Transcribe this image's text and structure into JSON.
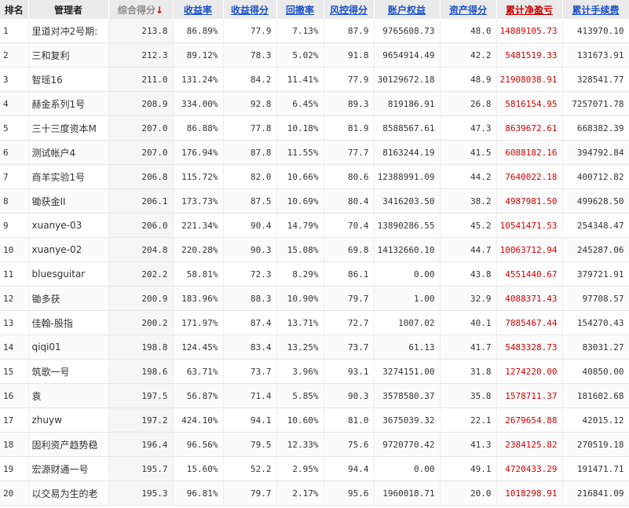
{
  "headers": {
    "rank": "排名",
    "manager": "管理者",
    "composite": "综合得分",
    "sort_arrow": "↓",
    "return_rate": "收益率",
    "return_score": "收益得分",
    "drawdown": "回撤率",
    "risk_score": "风控得分",
    "equity": "账户权益",
    "asset_score": "资产得分",
    "net_pnl": "累计净盈亏",
    "fees": "累计手续费"
  },
  "rows": [
    {
      "rank": "1",
      "manager": "里道对冲2号期:",
      "composite": "213.8",
      "return_rate": "86.89%",
      "return_score": "77.9",
      "drawdown": "7.13%",
      "risk_score": "87.9",
      "equity": "9765608.73",
      "asset_score": "48.0",
      "net_pnl": "14889105.73",
      "fees": "413970.10"
    },
    {
      "rank": "2",
      "manager": "三和复利",
      "composite": "212.3",
      "return_rate": "89.12%",
      "return_score": "78.3",
      "drawdown": "5.02%",
      "risk_score": "91.8",
      "equity": "9654914.49",
      "asset_score": "42.2",
      "net_pnl": "5481519.33",
      "fees": "131673.91"
    },
    {
      "rank": "3",
      "manager": "智瑶16",
      "composite": "211.0",
      "return_rate": "131.24%",
      "return_score": "84.2",
      "drawdown": "11.41%",
      "risk_score": "77.9",
      "equity": "30129672.18",
      "asset_score": "48.9",
      "net_pnl": "21908038.91",
      "fees": "328541.77"
    },
    {
      "rank": "4",
      "manager": "赫金系列1号",
      "composite": "208.9",
      "return_rate": "334.00%",
      "return_score": "92.8",
      "drawdown": "6.45%",
      "risk_score": "89.3",
      "equity": "819186.91",
      "asset_score": "26.8",
      "net_pnl": "5816154.95",
      "fees": "7257071.78"
    },
    {
      "rank": "5",
      "manager": "三十三度资本M",
      "composite": "207.0",
      "return_rate": "86.88%",
      "return_score": "77.8",
      "drawdown": "10.18%",
      "risk_score": "81.9",
      "equity": "8588567.61",
      "asset_score": "47.3",
      "net_pnl": "8639672.61",
      "fees": "668382.39"
    },
    {
      "rank": "6",
      "manager": "测试帐户4",
      "composite": "207.0",
      "return_rate": "176.94%",
      "return_score": "87.8",
      "drawdown": "11.55%",
      "risk_score": "77.7",
      "equity": "8163244.19",
      "asset_score": "41.5",
      "net_pnl": "6088182.16",
      "fees": "394792.84"
    },
    {
      "rank": "7",
      "manager": "商羊实验1号",
      "composite": "206.8",
      "return_rate": "115.72%",
      "return_score": "82.0",
      "drawdown": "10.66%",
      "risk_score": "80.6",
      "equity": "12388991.09",
      "asset_score": "44.2",
      "net_pnl": "7640022.18",
      "fees": "400712.82"
    },
    {
      "rank": "8",
      "manager": "锄获金II",
      "composite": "206.1",
      "return_rate": "173.73%",
      "return_score": "87.5",
      "drawdown": "10.69%",
      "risk_score": "80.4",
      "equity": "3416203.50",
      "asset_score": "38.2",
      "net_pnl": "4987981.50",
      "fees": "499628.50"
    },
    {
      "rank": "9",
      "manager": "xuanye-03",
      "composite": "206.0",
      "return_rate": "221.34%",
      "return_score": "90.4",
      "drawdown": "14.79%",
      "risk_score": "70.4",
      "equity": "13890286.55",
      "asset_score": "45.2",
      "net_pnl": "10541471.53",
      "fees": "254348.47"
    },
    {
      "rank": "10",
      "manager": "xuanye-02",
      "composite": "204.8",
      "return_rate": "220.28%",
      "return_score": "90.3",
      "drawdown": "15.08%",
      "risk_score": "69.8",
      "equity": "14132660.10",
      "asset_score": "44.7",
      "net_pnl": "10063712.94",
      "fees": "245287.06"
    },
    {
      "rank": "11",
      "manager": "bluesguitar",
      "composite": "202.2",
      "return_rate": "58.81%",
      "return_score": "72.3",
      "drawdown": "8.29%",
      "risk_score": "86.1",
      "equity": "0.00",
      "asset_score": "43.8",
      "net_pnl": "4551440.67",
      "fees": "379721.91"
    },
    {
      "rank": "12",
      "manager": "锄多获",
      "composite": "200.9",
      "return_rate": "183.96%",
      "return_score": "88.3",
      "drawdown": "10.90%",
      "risk_score": "79.7",
      "equity": "1.00",
      "asset_score": "32.9",
      "net_pnl": "4088371.43",
      "fees": "97708.57"
    },
    {
      "rank": "13",
      "manager": "佳翰-股指",
      "composite": "200.2",
      "return_rate": "171.97%",
      "return_score": "87.4",
      "drawdown": "13.71%",
      "risk_score": "72.7",
      "equity": "1007.02",
      "asset_score": "40.1",
      "net_pnl": "7885467.44",
      "fees": "154270.43"
    },
    {
      "rank": "14",
      "manager": "qiqi01",
      "composite": "198.8",
      "return_rate": "124.45%",
      "return_score": "83.4",
      "drawdown": "13.25%",
      "risk_score": "73.7",
      "equity": "61.13",
      "asset_score": "41.7",
      "net_pnl": "5483328.73",
      "fees": "83031.27"
    },
    {
      "rank": "15",
      "manager": "筑歌一号",
      "composite": "198.6",
      "return_rate": "63.71%",
      "return_score": "73.7",
      "drawdown": "3.96%",
      "risk_score": "93.1",
      "equity": "3274151.00",
      "asset_score": "31.8",
      "net_pnl": "1274220.00",
      "fees": "40850.00"
    },
    {
      "rank": "16",
      "manager": "袁",
      "composite": "197.5",
      "return_rate": "56.87%",
      "return_score": "71.4",
      "drawdown": "5.85%",
      "risk_score": "90.3",
      "equity": "3578580.37",
      "asset_score": "35.8",
      "net_pnl": "1578711.37",
      "fees": "181602.68"
    },
    {
      "rank": "17",
      "manager": "zhuyw",
      "composite": "197.2",
      "return_rate": "424.10%",
      "return_score": "94.1",
      "drawdown": "10.60%",
      "risk_score": "81.0",
      "equity": "3675039.32",
      "asset_score": "22.1",
      "net_pnl": "2679654.88",
      "fees": "42015.12"
    },
    {
      "rank": "18",
      "manager": "固利资产趋势稳",
      "composite": "196.4",
      "return_rate": "96.56%",
      "return_score": "79.5",
      "drawdown": "12.33%",
      "risk_score": "75.6",
      "equity": "9720770.42",
      "asset_score": "41.3",
      "net_pnl": "2384125.82",
      "fees": "270519.18"
    },
    {
      "rank": "19",
      "manager": "宏源财通一号",
      "composite": "195.7",
      "return_rate": "15.60%",
      "return_score": "52.2",
      "drawdown": "2.95%",
      "risk_score": "94.4",
      "equity": "0.00",
      "asset_score": "49.1",
      "net_pnl": "4720433.29",
      "fees": "191471.71"
    },
    {
      "rank": "20",
      "manager": "以交易为生的老",
      "composite": "195.3",
      "return_rate": "96.81%",
      "return_score": "79.7",
      "drawdown": "2.17%",
      "risk_score": "95.6",
      "equity": "1960018.71",
      "asset_score": "20.0",
      "net_pnl": "1018298.91",
      "fees": "216841.09"
    }
  ],
  "colors": {
    "link": "#1a4fc9",
    "accent_red": "#d40000",
    "header_bg": "#eaeaea"
  }
}
